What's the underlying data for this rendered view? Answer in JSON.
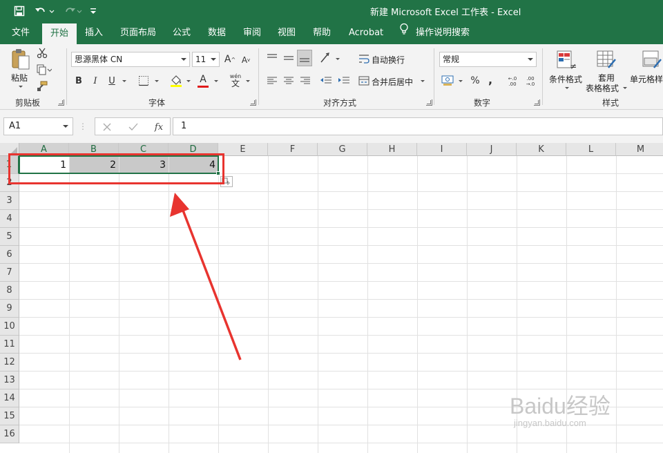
{
  "window": {
    "title": "新建 Microsoft Excel 工作表  -  Excel"
  },
  "ribbon_tabs": [
    {
      "label": "文件"
    },
    {
      "label": "开始"
    },
    {
      "label": "插入"
    },
    {
      "label": "页面布局"
    },
    {
      "label": "公式"
    },
    {
      "label": "数据"
    },
    {
      "label": "审阅"
    },
    {
      "label": "视图"
    },
    {
      "label": "帮助"
    },
    {
      "label": "Acrobat"
    },
    {
      "label": "操作说明搜索"
    }
  ],
  "ribbon": {
    "clipboard": {
      "paste_label": "粘贴",
      "group_label": "剪贴板"
    },
    "font": {
      "font_name": "思源黑体 CN",
      "font_size": "11",
      "bold": "B",
      "italic": "I",
      "underline": "U",
      "grow": "A",
      "shrink": "A",
      "color_letter": "A",
      "phonetic_top": "wén",
      "phonetic_bottom": "文",
      "group_label": "字体"
    },
    "alignment": {
      "wrap_text": "自动换行",
      "merge_center": "合并后居中",
      "group_label": "对齐方式"
    },
    "number": {
      "format": "常规",
      "percent": "%",
      "comma": ",",
      "inc_decimal": "←.0 .00",
      "dec_decimal": ".00 →.0",
      "group_label": "数字"
    },
    "styles": {
      "conditional": "条件格式",
      "table_line1": "套用",
      "table_line2": "表格格式",
      "cell_styles": "单元格样",
      "group_label": "样式"
    }
  },
  "formula_bar": {
    "name_box": "A1",
    "fx_label": "fx",
    "formula": "1"
  },
  "sheet": {
    "columns": [
      "A",
      "B",
      "C",
      "D",
      "E",
      "F",
      "G",
      "H",
      "I",
      "J",
      "K",
      "L",
      "M"
    ],
    "rows": [
      "1",
      "2",
      "3",
      "4",
      "5",
      "6",
      "7",
      "8",
      "9",
      "10",
      "11",
      "12",
      "13",
      "14",
      "15",
      "16"
    ],
    "cells": [
      {
        "ref": "A1",
        "value": "1"
      },
      {
        "ref": "B1",
        "value": "2"
      },
      {
        "ref": "C1",
        "value": "3"
      },
      {
        "ref": "D1",
        "value": "4"
      }
    ]
  },
  "colors": {
    "excel_green": "#217346",
    "annotation_red": "#e8342f",
    "selection_fill": "#c9c9c9"
  },
  "watermark": {
    "brand": "Baidu经验",
    "url": "jingyan.baidu.com"
  }
}
